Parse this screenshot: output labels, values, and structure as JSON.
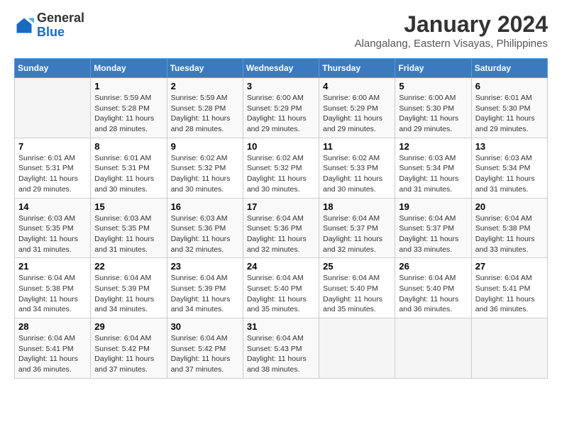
{
  "logo": {
    "general": "General",
    "blue": "Blue"
  },
  "title": "January 2024",
  "location": "Alangalang, Eastern Visayas, Philippines",
  "days_header": [
    "Sunday",
    "Monday",
    "Tuesday",
    "Wednesday",
    "Thursday",
    "Friday",
    "Saturday"
  ],
  "weeks": [
    [
      {
        "day": "",
        "info": ""
      },
      {
        "day": "1",
        "info": "Sunrise: 5:59 AM\nSunset: 5:28 PM\nDaylight: 11 hours and 28 minutes."
      },
      {
        "day": "2",
        "info": "Sunrise: 5:59 AM\nSunset: 5:28 PM\nDaylight: 11 hours and 28 minutes."
      },
      {
        "day": "3",
        "info": "Sunrise: 6:00 AM\nSunset: 5:29 PM\nDaylight: 11 hours and 29 minutes."
      },
      {
        "day": "4",
        "info": "Sunrise: 6:00 AM\nSunset: 5:29 PM\nDaylight: 11 hours and 29 minutes."
      },
      {
        "day": "5",
        "info": "Sunrise: 6:00 AM\nSunset: 5:30 PM\nDaylight: 11 hours and 29 minutes."
      },
      {
        "day": "6",
        "info": "Sunrise: 6:01 AM\nSunset: 5:30 PM\nDaylight: 11 hours and 29 minutes."
      }
    ],
    [
      {
        "day": "7",
        "info": "Sunrise: 6:01 AM\nSunset: 5:31 PM\nDaylight: 11 hours and 29 minutes."
      },
      {
        "day": "8",
        "info": "Sunrise: 6:01 AM\nSunset: 5:31 PM\nDaylight: 11 hours and 30 minutes."
      },
      {
        "day": "9",
        "info": "Sunrise: 6:02 AM\nSunset: 5:32 PM\nDaylight: 11 hours and 30 minutes."
      },
      {
        "day": "10",
        "info": "Sunrise: 6:02 AM\nSunset: 5:32 PM\nDaylight: 11 hours and 30 minutes."
      },
      {
        "day": "11",
        "info": "Sunrise: 6:02 AM\nSunset: 5:33 PM\nDaylight: 11 hours and 30 minutes."
      },
      {
        "day": "12",
        "info": "Sunrise: 6:03 AM\nSunset: 5:34 PM\nDaylight: 11 hours and 31 minutes."
      },
      {
        "day": "13",
        "info": "Sunrise: 6:03 AM\nSunset: 5:34 PM\nDaylight: 11 hours and 31 minutes."
      }
    ],
    [
      {
        "day": "14",
        "info": "Sunrise: 6:03 AM\nSunset: 5:35 PM\nDaylight: 11 hours and 31 minutes."
      },
      {
        "day": "15",
        "info": "Sunrise: 6:03 AM\nSunset: 5:35 PM\nDaylight: 11 hours and 31 minutes."
      },
      {
        "day": "16",
        "info": "Sunrise: 6:03 AM\nSunset: 5:36 PM\nDaylight: 11 hours and 32 minutes."
      },
      {
        "day": "17",
        "info": "Sunrise: 6:04 AM\nSunset: 5:36 PM\nDaylight: 11 hours and 32 minutes."
      },
      {
        "day": "18",
        "info": "Sunrise: 6:04 AM\nSunset: 5:37 PM\nDaylight: 11 hours and 32 minutes."
      },
      {
        "day": "19",
        "info": "Sunrise: 6:04 AM\nSunset: 5:37 PM\nDaylight: 11 hours and 33 minutes."
      },
      {
        "day": "20",
        "info": "Sunrise: 6:04 AM\nSunset: 5:38 PM\nDaylight: 11 hours and 33 minutes."
      }
    ],
    [
      {
        "day": "21",
        "info": "Sunrise: 6:04 AM\nSunset: 5:38 PM\nDaylight: 11 hours and 34 minutes."
      },
      {
        "day": "22",
        "info": "Sunrise: 6:04 AM\nSunset: 5:39 PM\nDaylight: 11 hours and 34 minutes."
      },
      {
        "day": "23",
        "info": "Sunrise: 6:04 AM\nSunset: 5:39 PM\nDaylight: 11 hours and 34 minutes."
      },
      {
        "day": "24",
        "info": "Sunrise: 6:04 AM\nSunset: 5:40 PM\nDaylight: 11 hours and 35 minutes."
      },
      {
        "day": "25",
        "info": "Sunrise: 6:04 AM\nSunset: 5:40 PM\nDaylight: 11 hours and 35 minutes."
      },
      {
        "day": "26",
        "info": "Sunrise: 6:04 AM\nSunset: 5:40 PM\nDaylight: 11 hours and 36 minutes."
      },
      {
        "day": "27",
        "info": "Sunrise: 6:04 AM\nSunset: 5:41 PM\nDaylight: 11 hours and 36 minutes."
      }
    ],
    [
      {
        "day": "28",
        "info": "Sunrise: 6:04 AM\nSunset: 5:41 PM\nDaylight: 11 hours and 36 minutes."
      },
      {
        "day": "29",
        "info": "Sunrise: 6:04 AM\nSunset: 5:42 PM\nDaylight: 11 hours and 37 minutes."
      },
      {
        "day": "30",
        "info": "Sunrise: 6:04 AM\nSunset: 5:42 PM\nDaylight: 11 hours and 37 minutes."
      },
      {
        "day": "31",
        "info": "Sunrise: 6:04 AM\nSunset: 5:43 PM\nDaylight: 11 hours and 38 minutes."
      },
      {
        "day": "",
        "info": ""
      },
      {
        "day": "",
        "info": ""
      },
      {
        "day": "",
        "info": ""
      }
    ]
  ]
}
